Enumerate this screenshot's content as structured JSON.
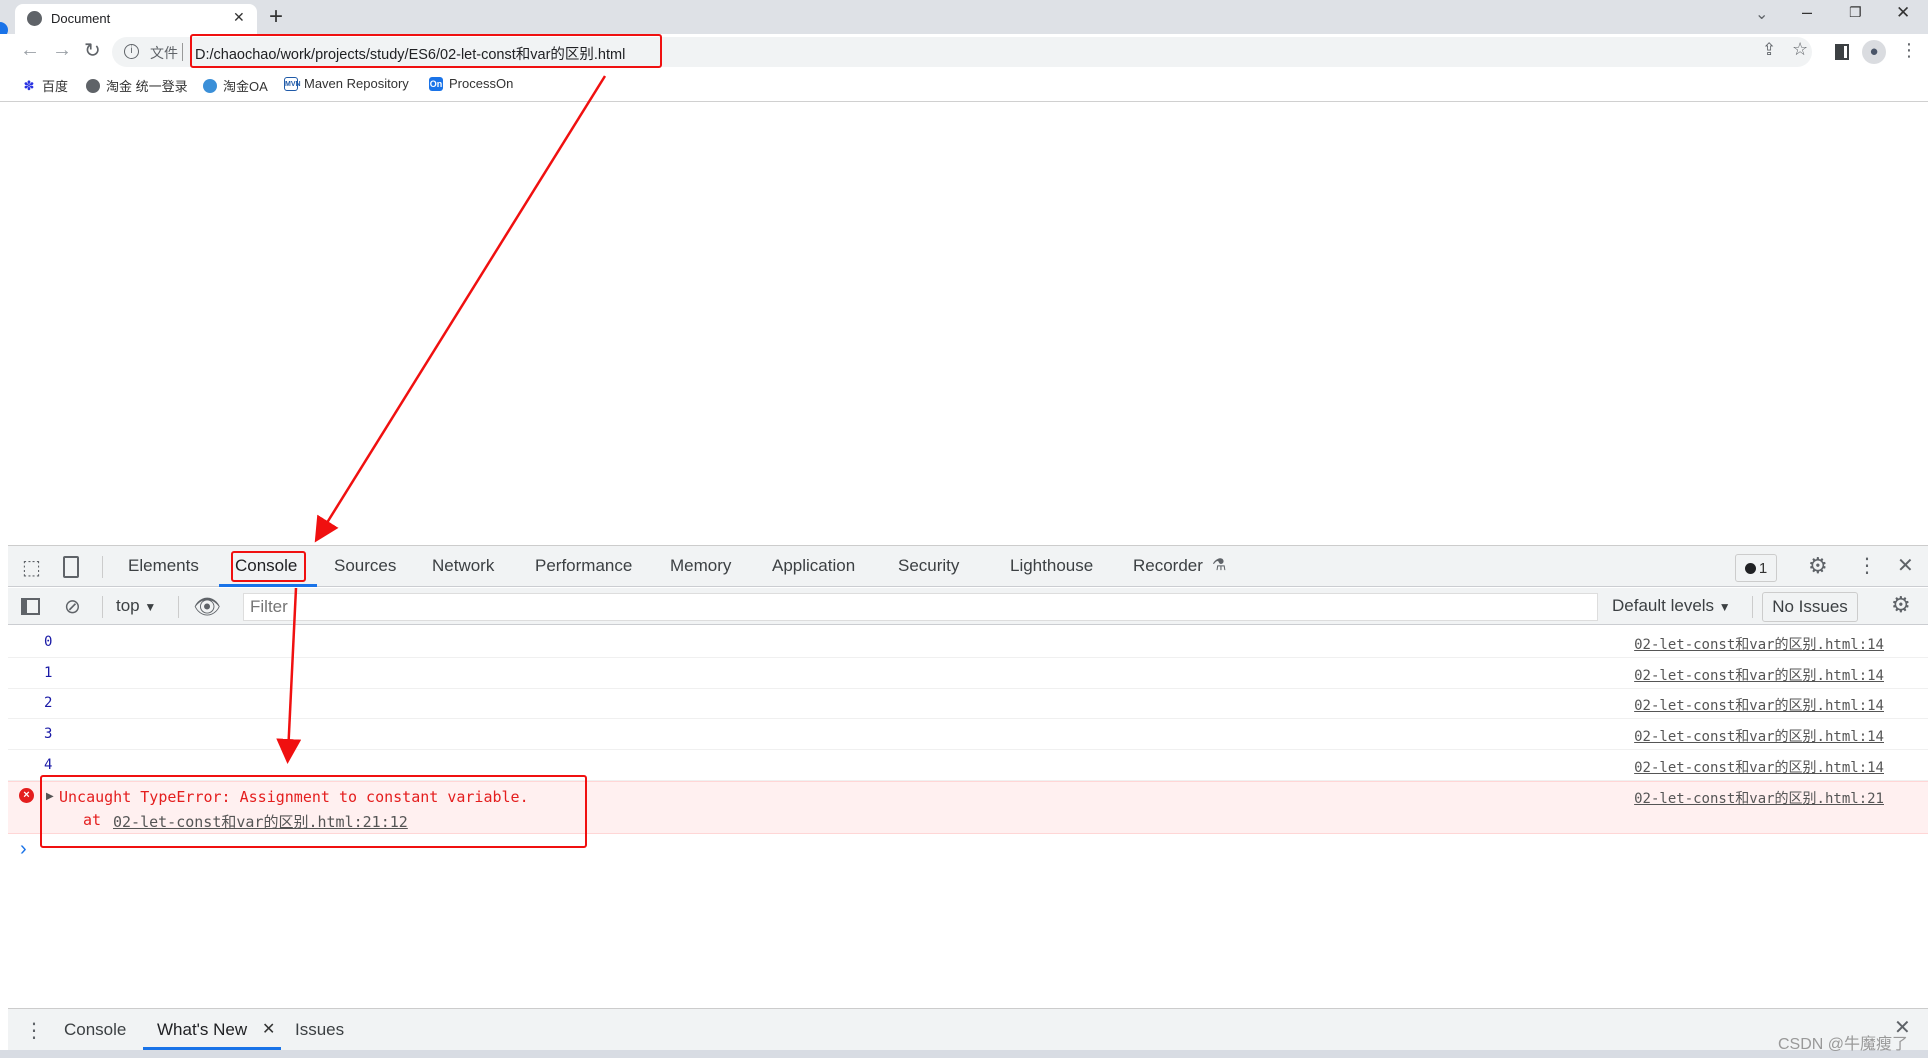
{
  "browser": {
    "tab_title": "Document",
    "tab_close": "✕",
    "new_tab": "+",
    "site_info_label": "文件",
    "url": "D:/chaochao/work/projects/study/ES6/02-let-const和var的区别.html",
    "bookmarks": [
      {
        "label": "百度",
        "icon": "baidu-paw-icon"
      },
      {
        "label": "淘金 统一登录",
        "icon": "globe-icon"
      },
      {
        "label": "淘金OA",
        "icon": "oa-icon"
      },
      {
        "label": "Maven Repository",
        "icon": "maven-icon",
        "icon_text": "MVN"
      },
      {
        "label": "ProcessOn",
        "icon": "processon-icon",
        "icon_text": "On"
      }
    ]
  },
  "devtools": {
    "tabs": [
      "Elements",
      "Console",
      "Sources",
      "Network",
      "Performance",
      "Memory",
      "Application",
      "Security",
      "Lighthouse",
      "Recorder"
    ],
    "active_tab": "Console",
    "error_count": "1",
    "context": "top",
    "filter_placeholder": "Filter",
    "levels": "Default levels",
    "issues": "No Issues",
    "logs": [
      {
        "value": "0",
        "source": "02-let-const和var的区别.html:14"
      },
      {
        "value": "1",
        "source": "02-let-const和var的区别.html:14"
      },
      {
        "value": "2",
        "source": "02-let-const和var的区别.html:14"
      },
      {
        "value": "3",
        "source": "02-let-const和var的区别.html:14"
      },
      {
        "value": "4",
        "source": "02-let-const和var的区别.html:14"
      }
    ],
    "error": {
      "message": "Uncaught TypeError: Assignment to constant variable.",
      "at_prefix": "at",
      "at_link": "02-let-const和var的区别.html:21:12",
      "source": "02-let-const和var的区别.html:21"
    },
    "prompt": "›",
    "drawer_tabs": [
      "Console",
      "What's New",
      "Issues"
    ],
    "drawer_active": "What's New"
  },
  "watermark": "CSDN @牛魔瘦了",
  "colors": {
    "accent": "#1a73e8",
    "error": "#e41e1e",
    "annotation": "#f01010",
    "log_number": "#1a1aa6"
  }
}
